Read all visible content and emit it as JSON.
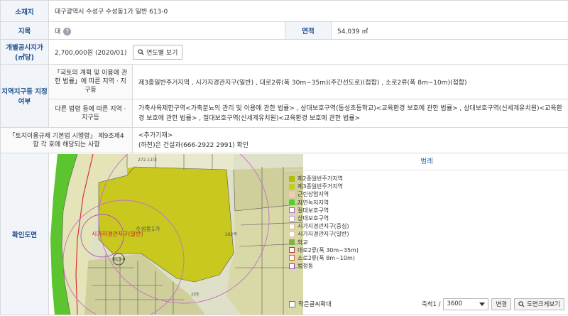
{
  "location": {
    "label": "소재지",
    "value": "대구광역시 수성구 수성동1가 일반 613-0"
  },
  "jimok": {
    "label": "지목",
    "value": "대",
    "help": "?"
  },
  "area": {
    "label": "면적",
    "value": "54,039 ㎡"
  },
  "price": {
    "label": "개별공시지가",
    "label_unit": "(㎡당)",
    "value": "2,700,000원 (2020/01)",
    "button": "연도별 보기"
  },
  "zoning": {
    "label": "지역지구등 지정여부",
    "law1": {
      "label": "「국토의 계획 및 이용에 관한 법률」에 따른 지역 · 지구등",
      "value": "제3종일반주거지역 , 시가지경관지구(일반) , 대로2류(폭 30m~35m)(주간선도로)(접합) , 소로2류(폭 8m~10m)(접합)"
    },
    "law2": {
      "label": "다른 법령 등에 따른 지역 · 지구등",
      "value": "가축사육제한구역<가축분뇨의 관리 및 이용에 관한 법률> , 상대보호구역(동성초등학교)<교육환경 보호에 관한 법률> , 상대보호구역(신세계유치원)<교육환경 보호에 관한 법률> , 절대보호구역(신세계유치원)<교육환경 보호에 관한 법률>"
    }
  },
  "regulation": {
    "label": "「토지이용규제 기본법 시행령」 제9조제4항 각 호에 해당되는 사항",
    "line1": "<추가기재>",
    "line2": "(하천)은 건설과(666-2922 2991) 확인"
  },
  "map_section": {
    "label": "확인도면",
    "labels": {
      "parcel": "613-0",
      "district": "시가지경관지구(일반)",
      "dong": "수성동1가",
      "n1": "272-11대",
      "n2": "282목",
      "n3": "지역"
    }
  },
  "legend": {
    "title": "범례",
    "items": [
      {
        "label": "제2종일반주거지역",
        "color": "#b5bd00",
        "style": "fill"
      },
      {
        "label": "제3종일반주거지역",
        "color": "#c8cc1e",
        "style": "fill"
      },
      {
        "label": "근린상업지역",
        "color": "#f2c9bb",
        "style": "fill"
      },
      {
        "label": "자연녹지지역",
        "color": "#4fcf2a",
        "style": "fill"
      },
      {
        "label": "절대보호구역",
        "color": "#b05ec8",
        "style": "outline"
      },
      {
        "label": "상대보호구역",
        "color": "#c99bd8",
        "style": "outline"
      },
      {
        "label": "시가지경관지구(중심)",
        "color": "#e8b09a",
        "style": "outline"
      },
      {
        "label": "시가지경관지구(일반)",
        "color": "#e8c4a0",
        "style": "outline"
      },
      {
        "label": "학교",
        "color": "#7fb347",
        "style": "fill"
      },
      {
        "label": "대로2류(폭 30m~35m)",
        "color": "#d8323a",
        "style": "outline"
      },
      {
        "label": "소로2류(폭 8m~10m)",
        "color": "#e05a40",
        "style": "outline"
      },
      {
        "label": "법정동",
        "color": "#8a3fc0",
        "style": "outline"
      }
    ],
    "enlarge_label": "작은글씨확대",
    "scale_label": "축척1 /",
    "scale_value": "3600",
    "change_button": "변경",
    "big_map_button": "도면크게보기"
  }
}
